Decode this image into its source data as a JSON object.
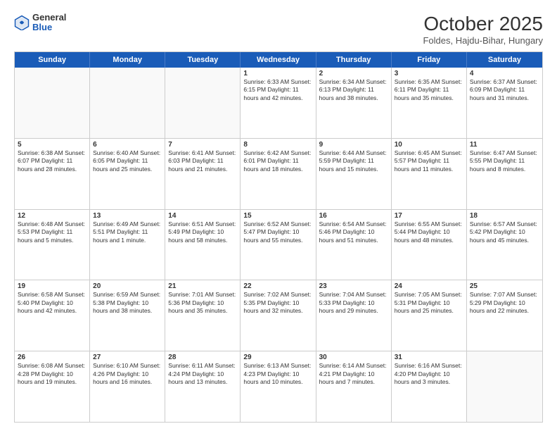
{
  "header": {
    "logo_general": "General",
    "logo_blue": "Blue",
    "month_title": "October 2025",
    "location": "Foldes, Hajdu-Bihar, Hungary"
  },
  "weekdays": [
    "Sunday",
    "Monday",
    "Tuesday",
    "Wednesday",
    "Thursday",
    "Friday",
    "Saturday"
  ],
  "rows": [
    [
      {
        "day": "",
        "text": ""
      },
      {
        "day": "",
        "text": ""
      },
      {
        "day": "",
        "text": ""
      },
      {
        "day": "1",
        "text": "Sunrise: 6:33 AM\nSunset: 6:15 PM\nDaylight: 11 hours\nand 42 minutes."
      },
      {
        "day": "2",
        "text": "Sunrise: 6:34 AM\nSunset: 6:13 PM\nDaylight: 11 hours\nand 38 minutes."
      },
      {
        "day": "3",
        "text": "Sunrise: 6:35 AM\nSunset: 6:11 PM\nDaylight: 11 hours\nand 35 minutes."
      },
      {
        "day": "4",
        "text": "Sunrise: 6:37 AM\nSunset: 6:09 PM\nDaylight: 11 hours\nand 31 minutes."
      }
    ],
    [
      {
        "day": "5",
        "text": "Sunrise: 6:38 AM\nSunset: 6:07 PM\nDaylight: 11 hours\nand 28 minutes."
      },
      {
        "day": "6",
        "text": "Sunrise: 6:40 AM\nSunset: 6:05 PM\nDaylight: 11 hours\nand 25 minutes."
      },
      {
        "day": "7",
        "text": "Sunrise: 6:41 AM\nSunset: 6:03 PM\nDaylight: 11 hours\nand 21 minutes."
      },
      {
        "day": "8",
        "text": "Sunrise: 6:42 AM\nSunset: 6:01 PM\nDaylight: 11 hours\nand 18 minutes."
      },
      {
        "day": "9",
        "text": "Sunrise: 6:44 AM\nSunset: 5:59 PM\nDaylight: 11 hours\nand 15 minutes."
      },
      {
        "day": "10",
        "text": "Sunrise: 6:45 AM\nSunset: 5:57 PM\nDaylight: 11 hours\nand 11 minutes."
      },
      {
        "day": "11",
        "text": "Sunrise: 6:47 AM\nSunset: 5:55 PM\nDaylight: 11 hours\nand 8 minutes."
      }
    ],
    [
      {
        "day": "12",
        "text": "Sunrise: 6:48 AM\nSunset: 5:53 PM\nDaylight: 11 hours\nand 5 minutes."
      },
      {
        "day": "13",
        "text": "Sunrise: 6:49 AM\nSunset: 5:51 PM\nDaylight: 11 hours\nand 1 minute."
      },
      {
        "day": "14",
        "text": "Sunrise: 6:51 AM\nSunset: 5:49 PM\nDaylight: 10 hours\nand 58 minutes."
      },
      {
        "day": "15",
        "text": "Sunrise: 6:52 AM\nSunset: 5:47 PM\nDaylight: 10 hours\nand 55 minutes."
      },
      {
        "day": "16",
        "text": "Sunrise: 6:54 AM\nSunset: 5:46 PM\nDaylight: 10 hours\nand 51 minutes."
      },
      {
        "day": "17",
        "text": "Sunrise: 6:55 AM\nSunset: 5:44 PM\nDaylight: 10 hours\nand 48 minutes."
      },
      {
        "day": "18",
        "text": "Sunrise: 6:57 AM\nSunset: 5:42 PM\nDaylight: 10 hours\nand 45 minutes."
      }
    ],
    [
      {
        "day": "19",
        "text": "Sunrise: 6:58 AM\nSunset: 5:40 PM\nDaylight: 10 hours\nand 42 minutes."
      },
      {
        "day": "20",
        "text": "Sunrise: 6:59 AM\nSunset: 5:38 PM\nDaylight: 10 hours\nand 38 minutes."
      },
      {
        "day": "21",
        "text": "Sunrise: 7:01 AM\nSunset: 5:36 PM\nDaylight: 10 hours\nand 35 minutes."
      },
      {
        "day": "22",
        "text": "Sunrise: 7:02 AM\nSunset: 5:35 PM\nDaylight: 10 hours\nand 32 minutes."
      },
      {
        "day": "23",
        "text": "Sunrise: 7:04 AM\nSunset: 5:33 PM\nDaylight: 10 hours\nand 29 minutes."
      },
      {
        "day": "24",
        "text": "Sunrise: 7:05 AM\nSunset: 5:31 PM\nDaylight: 10 hours\nand 25 minutes."
      },
      {
        "day": "25",
        "text": "Sunrise: 7:07 AM\nSunset: 5:29 PM\nDaylight: 10 hours\nand 22 minutes."
      }
    ],
    [
      {
        "day": "26",
        "text": "Sunrise: 6:08 AM\nSunset: 4:28 PM\nDaylight: 10 hours\nand 19 minutes."
      },
      {
        "day": "27",
        "text": "Sunrise: 6:10 AM\nSunset: 4:26 PM\nDaylight: 10 hours\nand 16 minutes."
      },
      {
        "day": "28",
        "text": "Sunrise: 6:11 AM\nSunset: 4:24 PM\nDaylight: 10 hours\nand 13 minutes."
      },
      {
        "day": "29",
        "text": "Sunrise: 6:13 AM\nSunset: 4:23 PM\nDaylight: 10 hours\nand 10 minutes."
      },
      {
        "day": "30",
        "text": "Sunrise: 6:14 AM\nSunset: 4:21 PM\nDaylight: 10 hours\nand 7 minutes."
      },
      {
        "day": "31",
        "text": "Sunrise: 6:16 AM\nSunset: 4:20 PM\nDaylight: 10 hours\nand 3 minutes."
      },
      {
        "day": "",
        "text": ""
      }
    ]
  ]
}
